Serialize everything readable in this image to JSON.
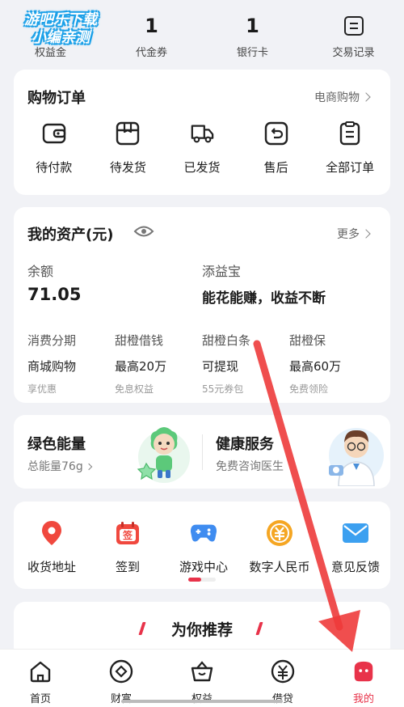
{
  "watermark": {
    "line1": "游吧乐下载",
    "line2": "小编亲测"
  },
  "top_stats": [
    {
      "value": "",
      "label": "权益金"
    },
    {
      "value": "1",
      "label": "代金券"
    },
    {
      "value": "1",
      "label": "银行卡"
    },
    {
      "value": "",
      "label": "交易记录"
    }
  ],
  "orders": {
    "title": "购物订单",
    "link": "电商购物",
    "items": [
      {
        "label": "待付款",
        "icon": "wallet-icon"
      },
      {
        "label": "待发货",
        "icon": "box-icon"
      },
      {
        "label": "已发货",
        "icon": "truck-icon"
      },
      {
        "label": "售后",
        "icon": "return-icon"
      },
      {
        "label": "全部订单",
        "icon": "list-icon"
      }
    ]
  },
  "assets": {
    "title": "我的资产(元)",
    "link": "更多",
    "balance_label": "余额",
    "balance_value": "71.05",
    "tyb_label": "添益宝",
    "tyb_slogan": "能花能赚，收益不断",
    "products": [
      {
        "title": "消费分期",
        "main": "商城购物",
        "sub": "享优惠"
      },
      {
        "title": "甜橙借钱",
        "main": "最高20万",
        "sub": "免息权益"
      },
      {
        "title": "甜橙白条",
        "main": "可提现",
        "sub": "55元券包"
      },
      {
        "title": "甜橙保",
        "main": "最高60万",
        "sub": "免费领险"
      }
    ]
  },
  "services": {
    "green_title": "绿色能量",
    "green_sub": "总能量76g",
    "health_title": "健康服务",
    "health_sub": "免费咨询医生"
  },
  "tools": [
    {
      "label": "收货地址",
      "icon": "location-icon",
      "color": "#f0483e"
    },
    {
      "label": "签到",
      "icon": "calendar-sign-icon",
      "color": "#f0483e"
    },
    {
      "label": "游戏中心",
      "icon": "gamepad-icon",
      "color": "#3f8cf0"
    },
    {
      "label": "数字人民币",
      "icon": "yuan-coin-icon",
      "color": "#f5a623"
    },
    {
      "label": "意见反馈",
      "icon": "mail-icon",
      "color": "#3ca0f0"
    }
  ],
  "recommend": {
    "title": "为你推荐"
  },
  "nav": [
    {
      "label": "首页",
      "icon": "home-icon"
    },
    {
      "label": "财富",
      "icon": "diamond-icon"
    },
    {
      "label": "权益",
      "icon": "basket-icon"
    },
    {
      "label": "借贷",
      "icon": "yuan-icon"
    },
    {
      "label": "我的",
      "icon": "profile-icon",
      "active": true
    }
  ],
  "colors": {
    "accent": "#e8334a",
    "background": "#f1f2f6"
  }
}
